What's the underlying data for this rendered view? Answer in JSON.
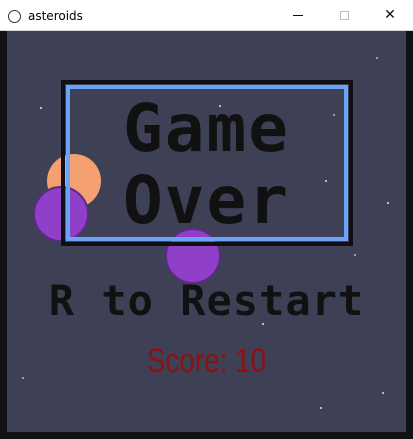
{
  "window": {
    "title": "asteroids",
    "icon": "circle-app-icon",
    "buttons": {
      "minimize": "minimize-icon",
      "maximize": "maximize-icon",
      "close": "close-icon",
      "close_glyph": "✕"
    }
  },
  "game": {
    "background_color": "#3e4155",
    "game_over_line1": "Game",
    "game_over_line2": "Over",
    "restart_prompt": "R to Restart",
    "score_text": "Score: 10",
    "score_color": "#8e1010",
    "frame_color": "#6aa3f7",
    "asteroid_colors": [
      "#f4a070",
      "#9040c8"
    ]
  }
}
